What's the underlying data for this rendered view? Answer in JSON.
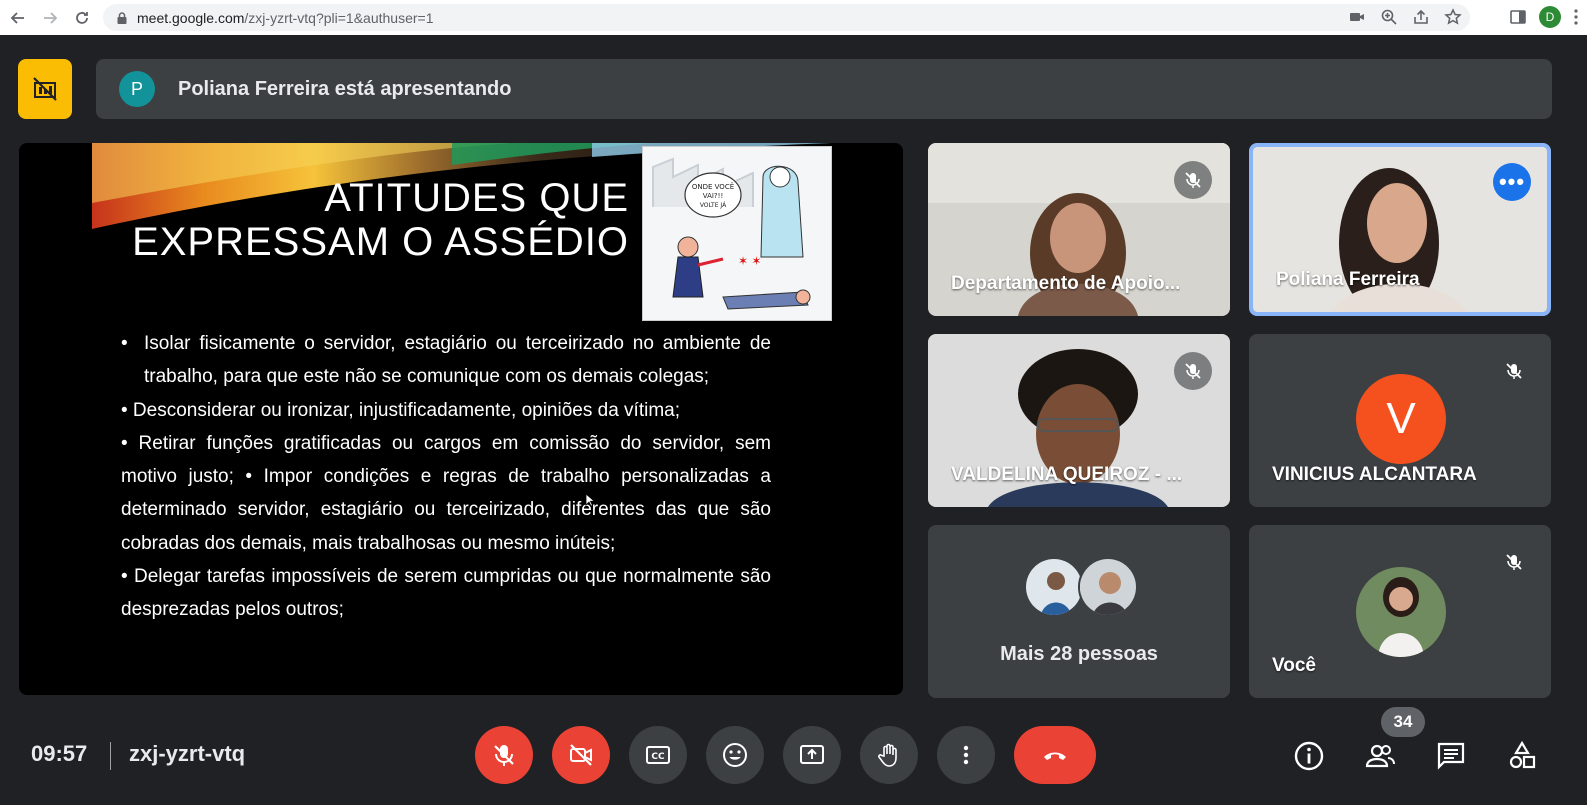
{
  "browser": {
    "url_host": "meet.google.com",
    "url_path": "/zxj-yzrt-vtq?pli=1&authuser=1",
    "profile_initial": "D"
  },
  "banner": {
    "presenter_initial": "P",
    "presenting_text": "Poliana Ferreira está apresentando"
  },
  "slide": {
    "title": "ATITUDES QUE\nEXPRESSAM O ASSÉDIO",
    "bullet1": "Isolar fisicamente o servidor, estagiário ou terceirizado no ambiente de trabalho, para que este não se comunique com os demais colegas;",
    "body": "• Desconsiderar ou ironizar, injustificadamente, opiniões da vítima;\n• Retirar funções gratificadas ou cargos em comissão do servidor, sem motivo justo; • Impor condições e regras de trabalho personalizadas a determinado servidor, estagiário ou terceirizado, diferentes das que são cobradas dos demais, mais trabalhosas ou mesmo inúteis;\n• Delegar tarefas impossíveis de serem cumpridas ou que normalmente são desprezadas pelos outros;",
    "cartoon_caption": "ONDE VOCÊ VAI?!! VOLTE JÁ AQUI E PRODUZA!!"
  },
  "participants": [
    {
      "name": "Departamento de Apoio...",
      "muted": true
    },
    {
      "name": "Poliana Ferreira",
      "muted": false,
      "active": true
    },
    {
      "name": "VALDELINA QUEIROZ - ...",
      "muted": true
    },
    {
      "name": "VINICIUS ALCANTARA",
      "muted": true,
      "initial": "V",
      "avatar_color": "#f4511e"
    }
  ],
  "more_people": "Mais 28 pessoas",
  "self": {
    "name": "Você",
    "muted": true
  },
  "footer": {
    "time": "09:57",
    "meeting_code": "zxj-yzrt-vtq",
    "participant_count": "34"
  },
  "colors": {
    "accent": "#1a73e8",
    "danger": "#ea4335",
    "warning": "#fbbc04",
    "surface": "#3c4043",
    "background": "#202124"
  }
}
